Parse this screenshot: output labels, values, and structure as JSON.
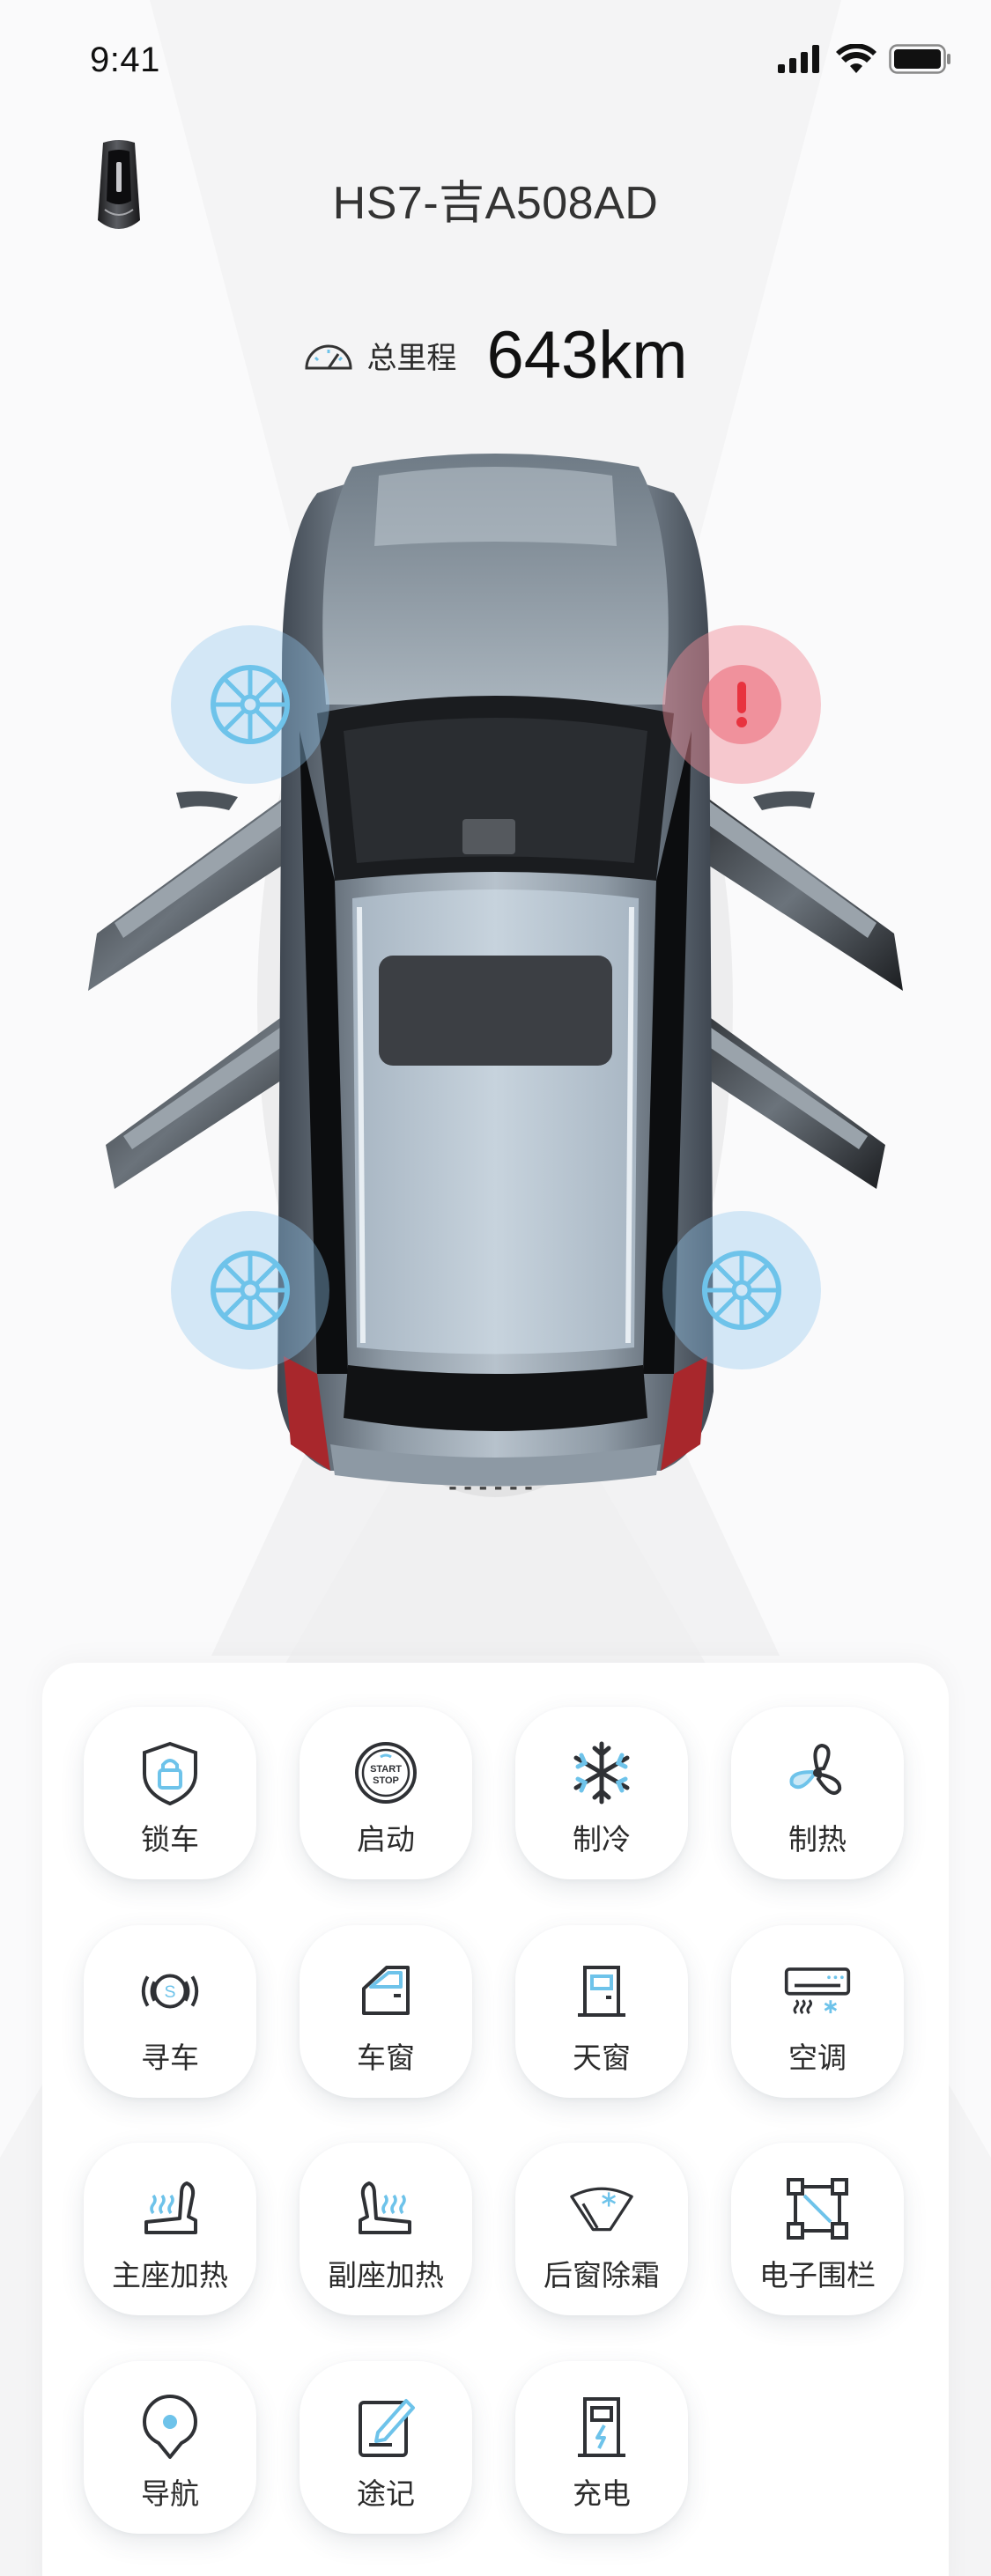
{
  "status_bar": {
    "time": "9:41"
  },
  "header": {
    "plate": "HS7-吉A508AD"
  },
  "mileage": {
    "label": "总里程",
    "value": "643km"
  },
  "tire_status": [
    {
      "position": "front-left",
      "status": "normal"
    },
    {
      "position": "front-right",
      "status": "warning"
    },
    {
      "position": "rear-left",
      "status": "normal"
    },
    {
      "position": "rear-right",
      "status": "normal"
    }
  ],
  "controls": [
    {
      "label": "锁车",
      "icon": "lock-shield-icon"
    },
    {
      "label": "启动",
      "icon": "start-stop-icon",
      "icon_text_1": "START",
      "icon_text_2": "STOP"
    },
    {
      "label": "制冷",
      "icon": "snowflake-icon"
    },
    {
      "label": "制热",
      "icon": "fan-icon"
    },
    {
      "label": "寻车",
      "icon": "find-car-icon",
      "icon_text": "S"
    },
    {
      "label": "车窗",
      "icon": "car-window-icon"
    },
    {
      "label": "天窗",
      "icon": "sunroof-icon"
    },
    {
      "label": "空调",
      "icon": "air-conditioner-icon"
    },
    {
      "label": "主座加热",
      "icon": "driver-seat-heat-icon"
    },
    {
      "label": "副座加热",
      "icon": "passenger-seat-heat-icon"
    },
    {
      "label": "后窗除霜",
      "icon": "rear-defrost-icon"
    },
    {
      "label": "电子围栏",
      "icon": "geofence-icon"
    },
    {
      "label": "导航",
      "icon": "navigation-pin-icon"
    },
    {
      "label": "途记",
      "icon": "trip-note-icon"
    },
    {
      "label": "充电",
      "icon": "charging-icon"
    }
  ],
  "colors": {
    "accent_blue": "#6ec3ea",
    "warning_red": "#e8333f",
    "icon_dark": "#2f3135"
  }
}
